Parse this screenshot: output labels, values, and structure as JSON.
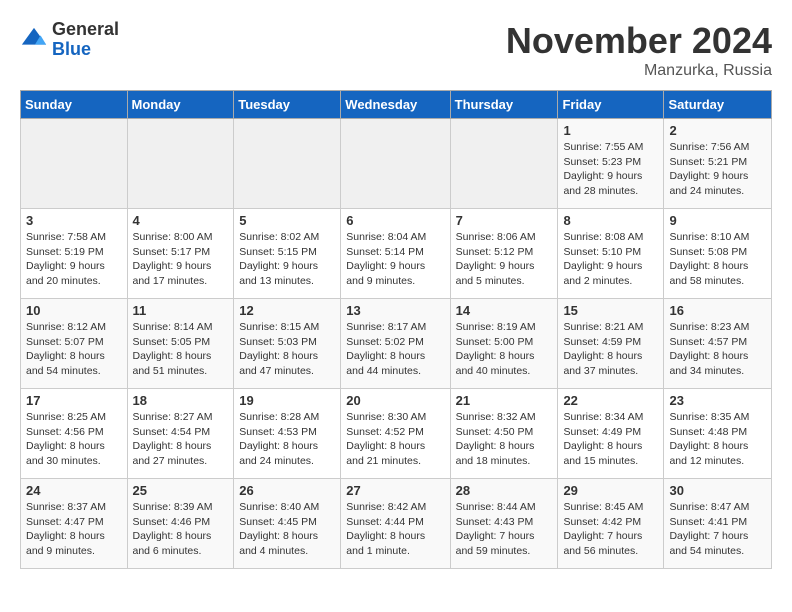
{
  "logo": {
    "general": "General",
    "blue": "Blue"
  },
  "title": "November 2024",
  "location": "Manzurka, Russia",
  "days_of_week": [
    "Sunday",
    "Monday",
    "Tuesday",
    "Wednesday",
    "Thursday",
    "Friday",
    "Saturday"
  ],
  "weeks": [
    [
      {
        "day": "",
        "info": ""
      },
      {
        "day": "",
        "info": ""
      },
      {
        "day": "",
        "info": ""
      },
      {
        "day": "",
        "info": ""
      },
      {
        "day": "",
        "info": ""
      },
      {
        "day": "1",
        "info": "Sunrise: 7:55 AM\nSunset: 5:23 PM\nDaylight: 9 hours and 28 minutes."
      },
      {
        "day": "2",
        "info": "Sunrise: 7:56 AM\nSunset: 5:21 PM\nDaylight: 9 hours and 24 minutes."
      }
    ],
    [
      {
        "day": "3",
        "info": "Sunrise: 7:58 AM\nSunset: 5:19 PM\nDaylight: 9 hours and 20 minutes."
      },
      {
        "day": "4",
        "info": "Sunrise: 8:00 AM\nSunset: 5:17 PM\nDaylight: 9 hours and 17 minutes."
      },
      {
        "day": "5",
        "info": "Sunrise: 8:02 AM\nSunset: 5:15 PM\nDaylight: 9 hours and 13 minutes."
      },
      {
        "day": "6",
        "info": "Sunrise: 8:04 AM\nSunset: 5:14 PM\nDaylight: 9 hours and 9 minutes."
      },
      {
        "day": "7",
        "info": "Sunrise: 8:06 AM\nSunset: 5:12 PM\nDaylight: 9 hours and 5 minutes."
      },
      {
        "day": "8",
        "info": "Sunrise: 8:08 AM\nSunset: 5:10 PM\nDaylight: 9 hours and 2 minutes."
      },
      {
        "day": "9",
        "info": "Sunrise: 8:10 AM\nSunset: 5:08 PM\nDaylight: 8 hours and 58 minutes."
      }
    ],
    [
      {
        "day": "10",
        "info": "Sunrise: 8:12 AM\nSunset: 5:07 PM\nDaylight: 8 hours and 54 minutes."
      },
      {
        "day": "11",
        "info": "Sunrise: 8:14 AM\nSunset: 5:05 PM\nDaylight: 8 hours and 51 minutes."
      },
      {
        "day": "12",
        "info": "Sunrise: 8:15 AM\nSunset: 5:03 PM\nDaylight: 8 hours and 47 minutes."
      },
      {
        "day": "13",
        "info": "Sunrise: 8:17 AM\nSunset: 5:02 PM\nDaylight: 8 hours and 44 minutes."
      },
      {
        "day": "14",
        "info": "Sunrise: 8:19 AM\nSunset: 5:00 PM\nDaylight: 8 hours and 40 minutes."
      },
      {
        "day": "15",
        "info": "Sunrise: 8:21 AM\nSunset: 4:59 PM\nDaylight: 8 hours and 37 minutes."
      },
      {
        "day": "16",
        "info": "Sunrise: 8:23 AM\nSunset: 4:57 PM\nDaylight: 8 hours and 34 minutes."
      }
    ],
    [
      {
        "day": "17",
        "info": "Sunrise: 8:25 AM\nSunset: 4:56 PM\nDaylight: 8 hours and 30 minutes."
      },
      {
        "day": "18",
        "info": "Sunrise: 8:27 AM\nSunset: 4:54 PM\nDaylight: 8 hours and 27 minutes."
      },
      {
        "day": "19",
        "info": "Sunrise: 8:28 AM\nSunset: 4:53 PM\nDaylight: 8 hours and 24 minutes."
      },
      {
        "day": "20",
        "info": "Sunrise: 8:30 AM\nSunset: 4:52 PM\nDaylight: 8 hours and 21 minutes."
      },
      {
        "day": "21",
        "info": "Sunrise: 8:32 AM\nSunset: 4:50 PM\nDaylight: 8 hours and 18 minutes."
      },
      {
        "day": "22",
        "info": "Sunrise: 8:34 AM\nSunset: 4:49 PM\nDaylight: 8 hours and 15 minutes."
      },
      {
        "day": "23",
        "info": "Sunrise: 8:35 AM\nSunset: 4:48 PM\nDaylight: 8 hours and 12 minutes."
      }
    ],
    [
      {
        "day": "24",
        "info": "Sunrise: 8:37 AM\nSunset: 4:47 PM\nDaylight: 8 hours and 9 minutes."
      },
      {
        "day": "25",
        "info": "Sunrise: 8:39 AM\nSunset: 4:46 PM\nDaylight: 8 hours and 6 minutes."
      },
      {
        "day": "26",
        "info": "Sunrise: 8:40 AM\nSunset: 4:45 PM\nDaylight: 8 hours and 4 minutes."
      },
      {
        "day": "27",
        "info": "Sunrise: 8:42 AM\nSunset: 4:44 PM\nDaylight: 8 hours and 1 minute."
      },
      {
        "day": "28",
        "info": "Sunrise: 8:44 AM\nSunset: 4:43 PM\nDaylight: 7 hours and 59 minutes."
      },
      {
        "day": "29",
        "info": "Sunrise: 8:45 AM\nSunset: 4:42 PM\nDaylight: 7 hours and 56 minutes."
      },
      {
        "day": "30",
        "info": "Sunrise: 8:47 AM\nSunset: 4:41 PM\nDaylight: 7 hours and 54 minutes."
      }
    ]
  ]
}
